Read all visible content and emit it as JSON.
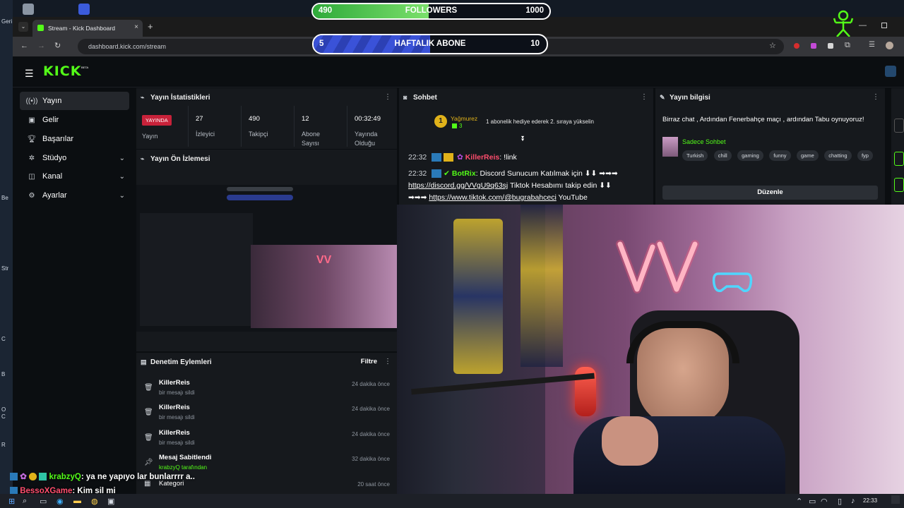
{
  "overlay": {
    "followers": {
      "label": "FOLLOWERS",
      "current": "490",
      "goal": "1000",
      "fraction": 0.49
    },
    "subs": {
      "label": "HAFTALIK ABONE",
      "current": "5",
      "goal": "10",
      "fraction": 0.5
    }
  },
  "desktop": {
    "labels": [
      "Geri D",
      "Be",
      "Str",
      "C",
      "B",
      "O",
      "C",
      "R"
    ]
  },
  "browser": {
    "tab_title": "Stream - Kick Dashboard",
    "url": "dashboard.kick.com/stream",
    "colors": {
      "accent": "#53fc18"
    }
  },
  "app": {
    "logo": "KICK",
    "logo_badge": "BETA",
    "nav": [
      {
        "label": "Yayın",
        "icon": "broadcast-icon",
        "active": true
      },
      {
        "label": "Gelir",
        "icon": "wallet-icon"
      },
      {
        "label": "Başarılar",
        "icon": "trophy-icon"
      },
      {
        "label": "Stüdyo",
        "icon": "studio-icon",
        "expandable": true
      },
      {
        "label": "Kanal",
        "icon": "channel-icon",
        "expandable": true
      },
      {
        "label": "Ayarlar",
        "icon": "gear-icon",
        "expandable": true
      }
    ],
    "stats": {
      "title": "Yayın İstatistikleri",
      "live_badge": "YAYINDA",
      "live_label": "Yayın",
      "items": [
        {
          "value": "27",
          "label": "İzleyici"
        },
        {
          "value": "490",
          "label": "Takipçi"
        },
        {
          "value": "12",
          "label": "Abone Sayısı"
        },
        {
          "value": "00:32:49",
          "label": "Yayında Olduğu"
        }
      ]
    },
    "preview": {
      "title": "Yayın Ön İzlemesi"
    },
    "mod": {
      "title": "Denetim Eylemleri",
      "filter": "Filtre",
      "rows": [
        {
          "icon": "trash-icon",
          "name": "KillerReis",
          "sub": "bir mesajı sildi",
          "time": "24 dakika önce"
        },
        {
          "icon": "trash-icon",
          "name": "KillerReis",
          "sub": "bir mesajı sildi",
          "time": "24 dakika önce"
        },
        {
          "icon": "trash-icon",
          "name": "KillerReis",
          "sub": "bir mesajı sildi",
          "time": "24 dakika önce"
        },
        {
          "icon": "pin-icon",
          "name": "Mesaj Sabitlendi",
          "sub": "krabzyQ tarafından",
          "time": "32 dakika önce"
        },
        {
          "icon": "category-icon",
          "name": "Kategori",
          "sub": "",
          "time": "20 saat önce"
        }
      ]
    },
    "chat": {
      "title": "Sohbet",
      "gift_rank": "1",
      "gift_user": "Yağmurez",
      "gift_count": "3",
      "gift_text": "1 abonelik hediye ederek 2. sıraya yükselin",
      "messages": [
        {
          "time": "22:32",
          "user": "KillerReis",
          "text": ": !link"
        },
        {
          "time": "22:32",
          "user": "BotRix",
          "text": ": Discord Sunucum Katılmak için ⬇⬇ ➡➡➡",
          "link1": "https://discord.gg/VVgU9q63sj",
          "text2": "Tiktok Hesabımı takip edin ⬇⬇",
          "link2": "https://www.tiktok.com/@bugrabahceci",
          "text3": "YouTube"
        }
      ]
    },
    "info": {
      "title": "Yayın bilgisi",
      "description": "Birraz chat , Ardından Fenerbahçe maçı , ardından Tabu oynuyoruz!",
      "category": "Sadece Sohbet",
      "tags": [
        "Turkish",
        "chill",
        "gaming",
        "funny",
        "game",
        "chatting",
        "fyp"
      ],
      "edit": "Düzenle"
    }
  },
  "stream_chat": [
    {
      "user": "krabzyQ",
      "text": ": ya ne yapıyo lar bunlarrrr a..",
      "color": "#53fc18"
    },
    {
      "user": "BessoXGame",
      "text": ": Kim sil mi",
      "color": "#ff4d6d"
    }
  ],
  "taskbar": {
    "clock": "22:33"
  }
}
